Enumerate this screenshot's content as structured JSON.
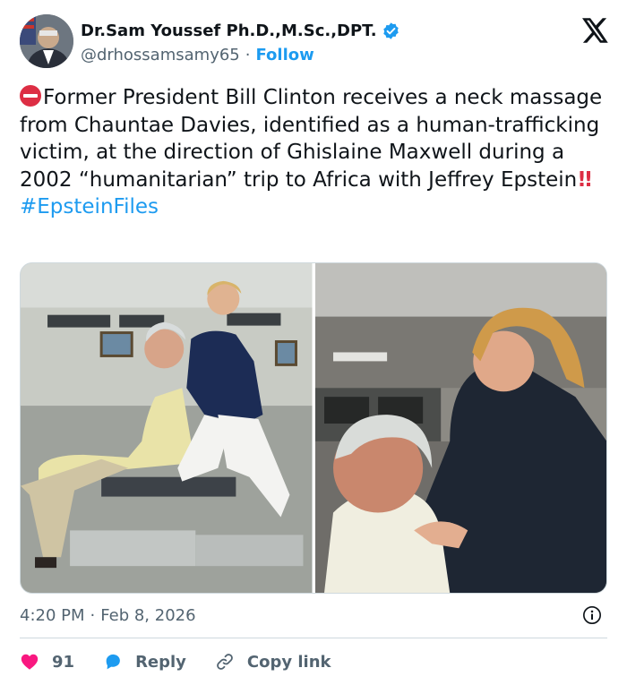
{
  "author": {
    "display_name": "Dr.Sam Youssef Ph.D.,M.Sc.,DPT.",
    "handle": "@drhossamsamy65",
    "separator": "·",
    "follow_label": "Follow"
  },
  "tweet": {
    "text_main": "Former President Bill Clinton receives a neck massage from Chauntae Davies, identified as a human-trafficking victim, at the direction of Ghislaine Maxwell during a 2002 “humanitarian” trip to Africa with Jeffrey Epstein",
    "emphasis": "!!",
    "hashtag": "#EpsteinFiles"
  },
  "media": {
    "count": 2
  },
  "meta": {
    "time": "4:20 PM",
    "separator": "·",
    "date": "Feb 8, 2026"
  },
  "actions": {
    "like_count": "91",
    "reply_label": "Reply",
    "copy_link_label": "Copy link"
  },
  "colors": {
    "accent": "#1d9bf0",
    "like": "#f91880",
    "text": "#0f1419",
    "muted": "#536471"
  },
  "icons": [
    "verified-badge-icon",
    "x-logo-icon",
    "no-entry-icon",
    "info-icon",
    "heart-icon",
    "reply-bubble-icon",
    "link-icon"
  ]
}
